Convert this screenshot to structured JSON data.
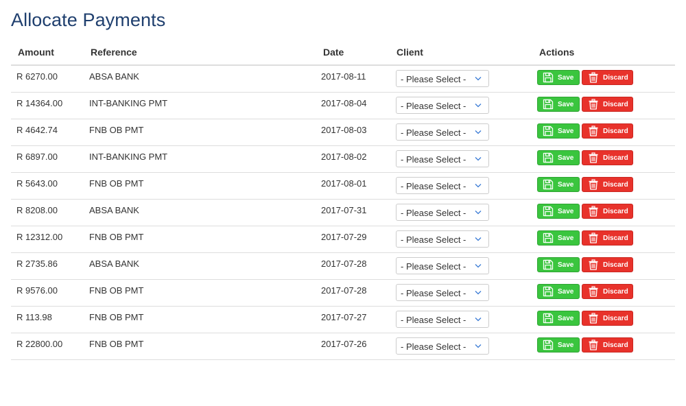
{
  "page": {
    "title": "Allocate Payments"
  },
  "table": {
    "headers": {
      "amount": "Amount",
      "reference": "Reference",
      "date": "Date",
      "client": "Client",
      "actions": "Actions"
    },
    "select_placeholder": "- Please Select -",
    "save_label": "Save",
    "discard_label": "Discard",
    "rows": [
      {
        "amount": "R 6270.00",
        "reference": "ABSA BANK",
        "date": "2017-08-11"
      },
      {
        "amount": "R 14364.00",
        "reference": "INT-BANKING PMT",
        "date": "2017-08-04"
      },
      {
        "amount": "R 4642.74",
        "reference": "FNB OB PMT",
        "date": "2017-08-03"
      },
      {
        "amount": "R 6897.00",
        "reference": "INT-BANKING PMT",
        "date": "2017-08-02"
      },
      {
        "amount": "R 5643.00",
        "reference": "FNB OB PMT",
        "date": "2017-08-01"
      },
      {
        "amount": "R 8208.00",
        "reference": "ABSA BANK",
        "date": "2017-07-31"
      },
      {
        "amount": "R 12312.00",
        "reference": "FNB OB PMT",
        "date": "2017-07-29"
      },
      {
        "amount": "R 2735.86",
        "reference": "ABSA BANK",
        "date": "2017-07-28"
      },
      {
        "amount": "R 9576.00",
        "reference": "FNB OB PMT",
        "date": "2017-07-28"
      },
      {
        "amount": "R 113.98",
        "reference": "FNB OB PMT",
        "date": "2017-07-27"
      },
      {
        "amount": "R 22800.00",
        "reference": "FNB OB PMT",
        "date": "2017-07-26"
      }
    ]
  },
  "colors": {
    "title": "#1f3f6e",
    "save": "#3ac53e",
    "discard": "#e8322b",
    "select_chevron": "#3a7bd5"
  },
  "icons": {
    "save": "floppy-disk-icon",
    "discard": "trash-icon",
    "select": "chevron-down-icon"
  }
}
